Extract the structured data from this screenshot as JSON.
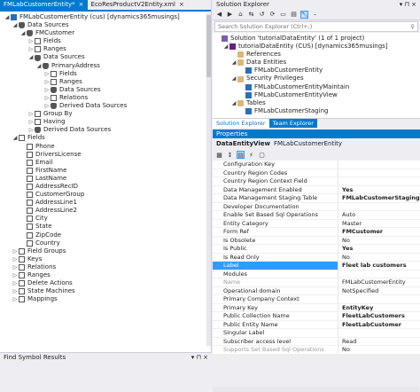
{
  "editor": {
    "tabs": [
      {
        "label": "FMLabCustomerEntity*",
        "active": true
      },
      {
        "label": "EcoResProductV2Entity.xml",
        "active": false
      }
    ],
    "close_glyph": "×",
    "tree": [
      {
        "level": 0,
        "exp": "◢",
        "icon": "ent",
        "label": "FMLabCustomerEntity (cus) [dynamics365musings]"
      },
      {
        "level": 1,
        "exp": "◢",
        "icon": "db",
        "label": "Data Sources"
      },
      {
        "level": 2,
        "exp": "◢",
        "icon": "db",
        "label": "FMCustomer"
      },
      {
        "level": 3,
        "exp": "▷",
        "icon": "fld",
        "label": "Fields"
      },
      {
        "level": 3,
        "exp": "▷",
        "icon": "fld",
        "label": "Ranges"
      },
      {
        "level": 3,
        "exp": "◢",
        "icon": "db",
        "label": "Data Sources"
      },
      {
        "level": 4,
        "exp": "◢",
        "icon": "db",
        "label": "PrimaryAddress"
      },
      {
        "level": 5,
        "exp": "▷",
        "icon": "fld",
        "label": "Fields"
      },
      {
        "level": 5,
        "exp": "▷",
        "icon": "fld",
        "label": "Ranges"
      },
      {
        "level": 5,
        "exp": "▷",
        "icon": "db",
        "label": "Data Sources"
      },
      {
        "level": 5,
        "exp": "▷",
        "icon": "fld",
        "label": "Relations"
      },
      {
        "level": 5,
        "exp": "▷",
        "icon": "db",
        "label": "Derived Data Sources"
      },
      {
        "level": 3,
        "exp": "▷",
        "icon": "fld",
        "label": "Group By"
      },
      {
        "level": 3,
        "exp": "▷",
        "icon": "fld",
        "label": "Having"
      },
      {
        "level": 3,
        "exp": "▷",
        "icon": "db",
        "label": "Derived Data Sources"
      },
      {
        "level": 1,
        "exp": "◢",
        "icon": "fld",
        "label": "Fields"
      },
      {
        "level": 2,
        "exp": "",
        "icon": "fld",
        "label": "Phone"
      },
      {
        "level": 2,
        "exp": "",
        "icon": "fld",
        "label": "DriversLicense"
      },
      {
        "level": 2,
        "exp": "",
        "icon": "fld",
        "label": "Email"
      },
      {
        "level": 2,
        "exp": "",
        "icon": "fld",
        "label": "FirstName"
      },
      {
        "level": 2,
        "exp": "",
        "icon": "fld",
        "label": "LastName"
      },
      {
        "level": 2,
        "exp": "",
        "icon": "fld",
        "label": "AddressRecID"
      },
      {
        "level": 2,
        "exp": "",
        "icon": "fld",
        "label": "CustomerGroup"
      },
      {
        "level": 2,
        "exp": "",
        "icon": "fld",
        "label": "AddressLine1"
      },
      {
        "level": 2,
        "exp": "",
        "icon": "fld",
        "label": "AddressLine2"
      },
      {
        "level": 2,
        "exp": "",
        "icon": "fld",
        "label": "City"
      },
      {
        "level": 2,
        "exp": "",
        "icon": "fld",
        "label": "State"
      },
      {
        "level": 2,
        "exp": "",
        "icon": "fld",
        "label": "ZipCode"
      },
      {
        "level": 2,
        "exp": "",
        "icon": "fld",
        "label": "Country"
      },
      {
        "level": 1,
        "exp": "▷",
        "icon": "fld",
        "label": "Field Groups"
      },
      {
        "level": 1,
        "exp": "▷",
        "icon": "fld",
        "label": "Keys"
      },
      {
        "level": 1,
        "exp": "▷",
        "icon": "fld",
        "label": "Relations"
      },
      {
        "level": 1,
        "exp": "▷",
        "icon": "fld",
        "label": "Ranges"
      },
      {
        "level": 1,
        "exp": "▷",
        "icon": "fld",
        "label": "Delete Actions"
      },
      {
        "level": 1,
        "exp": "▷",
        "icon": "fld",
        "label": "State Machines"
      },
      {
        "level": 1,
        "exp": "▷",
        "icon": "fld",
        "label": "Mappings"
      }
    ]
  },
  "find_symbol": {
    "title": "Find Symbol Results"
  },
  "solution_explorer": {
    "title": "Solution Explorer",
    "search_placeholder": "Search Solution Explorer (Ctrl+;)",
    "tree": [
      {
        "level": 0,
        "exp": "",
        "icon": "sol",
        "label": "Solution 'tutorialDataEntity' (1 of 1 project)"
      },
      {
        "level": 1,
        "exp": "◢",
        "icon": "proj",
        "label": "tutorialDataEntity (CUS) [dynamics365musings]"
      },
      {
        "level": 2,
        "exp": "",
        "icon": "fold",
        "label": "References"
      },
      {
        "level": 2,
        "exp": "◢",
        "icon": "fold",
        "label": "Data Entities"
      },
      {
        "level": 3,
        "exp": "",
        "icon": "ent",
        "label": "FMLabCustomerEntity"
      },
      {
        "level": 2,
        "exp": "◢",
        "icon": "fold",
        "label": "Security Privileges"
      },
      {
        "level": 3,
        "exp": "",
        "icon": "ent",
        "label": "FMLabCustomerEntityMaintain"
      },
      {
        "level": 3,
        "exp": "",
        "icon": "ent",
        "label": "FMLabCustomerEntityView"
      },
      {
        "level": 2,
        "exp": "◢",
        "icon": "fold",
        "label": "Tables"
      },
      {
        "level": 3,
        "exp": "",
        "icon": "ent",
        "label": "FMLabCustomerStaging"
      }
    ],
    "bottom_tabs": [
      {
        "label": "Solution Explorer",
        "active": true
      },
      {
        "label": "Team Explorer",
        "active": false
      }
    ]
  },
  "properties": {
    "title": "Properties",
    "object_type": "DataEntityView",
    "object_name": "FMLabCustomerEntity",
    "rows": [
      {
        "key": "Configuration Key",
        "value": "",
        "bold": false,
        "dim": false,
        "sel": false
      },
      {
        "key": "Country Region Codes",
        "value": "",
        "bold": false,
        "dim": false,
        "sel": false
      },
      {
        "key": "Country Region Context Field",
        "value": "",
        "bold": false,
        "dim": false,
        "sel": false
      },
      {
        "key": "Data Management Enabled",
        "value": "Yes",
        "bold": true,
        "dim": false,
        "sel": false
      },
      {
        "key": "Data Management Staging Table",
        "value": "FMLabCustomerStaging",
        "bold": true,
        "dim": false,
        "sel": false
      },
      {
        "key": "Developer Documentation",
        "value": "",
        "bold": false,
        "dim": false,
        "sel": false
      },
      {
        "key": "Enable Set Based Sql Operations",
        "value": "Auto",
        "bold": false,
        "dim": false,
        "sel": false
      },
      {
        "key": "Entity Category",
        "value": "Master",
        "bold": false,
        "dim": false,
        "sel": false
      },
      {
        "key": "Form Ref",
        "value": "FMCustomer",
        "bold": true,
        "dim": false,
        "sel": false
      },
      {
        "key": "Is Obsolete",
        "value": "No",
        "bold": false,
        "dim": false,
        "sel": false
      },
      {
        "key": "Is Public",
        "value": "Yes",
        "bold": true,
        "dim": false,
        "sel": false
      },
      {
        "key": "Is Read Only",
        "value": "No",
        "bold": false,
        "dim": false,
        "sel": false
      },
      {
        "key": "Label",
        "value": "Fleet lab customers",
        "bold": true,
        "dim": false,
        "sel": true
      },
      {
        "key": "Modules",
        "value": "",
        "bold": false,
        "dim": false,
        "sel": false
      },
      {
        "key": "Name",
        "value": "FMLabCustomerEntity",
        "bold": false,
        "dim": true,
        "sel": false
      },
      {
        "key": "Operational domain",
        "value": "NotSpecified",
        "bold": false,
        "dim": false,
        "sel": false
      },
      {
        "key": "Primary Company Context",
        "value": "",
        "bold": false,
        "dim": false,
        "sel": false
      },
      {
        "key": "Primary Key",
        "value": "EntityKey",
        "bold": true,
        "dim": false,
        "sel": false
      },
      {
        "key": "Public Collection Name",
        "value": "FleetLabCustomers",
        "bold": true,
        "dim": false,
        "sel": false
      },
      {
        "key": "Public Entity Name",
        "value": "FleetLabCustomer",
        "bold": true,
        "dim": false,
        "sel": false
      },
      {
        "key": "Singular Label",
        "value": "",
        "bold": false,
        "dim": false,
        "sel": false
      },
      {
        "key": "Subscriber access level",
        "value": "Read",
        "bold": false,
        "dim": false,
        "sel": false
      },
      {
        "key": "Supports Set Based Sql Operations",
        "value": "No",
        "bold": false,
        "dim": true,
        "sel": false
      }
    ]
  },
  "colors": {
    "accent": "#007acc",
    "selection": "#3399ff"
  }
}
